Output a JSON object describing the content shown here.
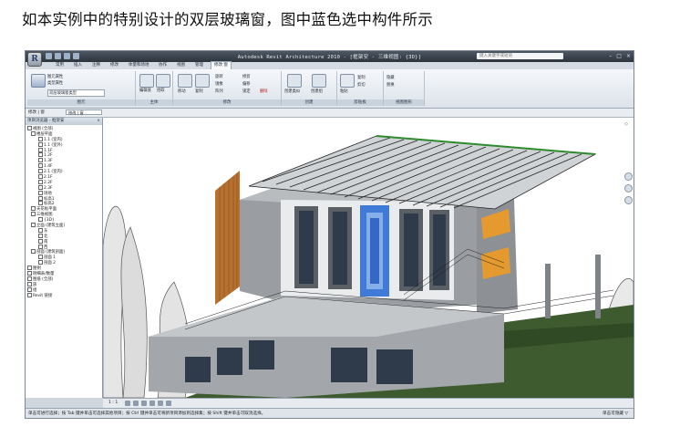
{
  "caption": "如本实例中的特别设计的双层玻璃窗，图中蓝色选中构件所示",
  "window": {
    "title": "Autodesk Revit Architecture 2010 - [框架安 - 三维视图: {3D}]",
    "app_button": "R",
    "search_placeholder": "键入关键字或短语",
    "controls": [
      "–",
      "□",
      "×"
    ]
  },
  "tabs": [
    {
      "label": "常用",
      "active": false
    },
    {
      "label": "插入",
      "active": false
    },
    {
      "label": "注释",
      "active": false
    },
    {
      "label": "修改",
      "active": false
    },
    {
      "label": "体量和场地",
      "active": false
    },
    {
      "label": "协作",
      "active": false
    },
    {
      "label": "视图",
      "active": false
    },
    {
      "label": "管理",
      "active": false
    },
    {
      "label": "修改 窗",
      "active": true
    }
  ],
  "ribbon": {
    "panels": [
      {
        "title": "图元",
        "buttons": [
          "图元属性",
          "类型属性",
          "双层玻璃窗类型"
        ]
      },
      {
        "title": "主体",
        "buttons": [
          "编辑族",
          "拾取"
        ]
      },
      {
        "title": "修改",
        "buttons": [
          "移动",
          "复制",
          "旋转",
          "镜像",
          "阵列",
          "修剪",
          "偏移",
          "锁定",
          "删除"
        ]
      },
      {
        "title": "创建",
        "buttons": [
          "创建类似",
          "创建组"
        ]
      },
      {
        "title": "剪贴板",
        "buttons": [
          "粘贴",
          "复制",
          "剪切"
        ]
      },
      {
        "title": "视图图形",
        "buttons": [
          "隐藏",
          "替换"
        ]
      }
    ]
  },
  "options_bar": {
    "label": "修改 | 窗",
    "field": "修改 | 窗"
  },
  "browser": {
    "title": "项目浏览器 - 框架安",
    "close": "×",
    "items": [
      "视图 (全部)",
      "楼层平面",
      "1.1 (室内)",
      "1.1 (室外)",
      "1.1F",
      "1.2F",
      "1.3F",
      "1.4F",
      "2.1 (室内)",
      "2.1F",
      "2.2F",
      "2.3F",
      "场地",
      "标高1",
      "标高2",
      "天花板平面",
      "三维视图",
      "{3D}",
      "立面 (建筑立面)",
      "东",
      "北",
      "南",
      "西",
      "剖面 (建筑剖面)",
      "剖面 1",
      "剖面 2",
      "图例",
      "明细表/数量",
      "图纸 (全部)",
      "族",
      "组",
      "Revit 链接"
    ]
  },
  "view_control": {
    "scale": "1 : 1"
  },
  "status_bar": {
    "message": "单击可进行选择；按 Tab 键并单击可选择其他项目；按 Ctrl 键并单击可将新项目添加到选择集；按 Shift 键并单击可取消选择。",
    "right": "单击可隐藏 ▽"
  }
}
